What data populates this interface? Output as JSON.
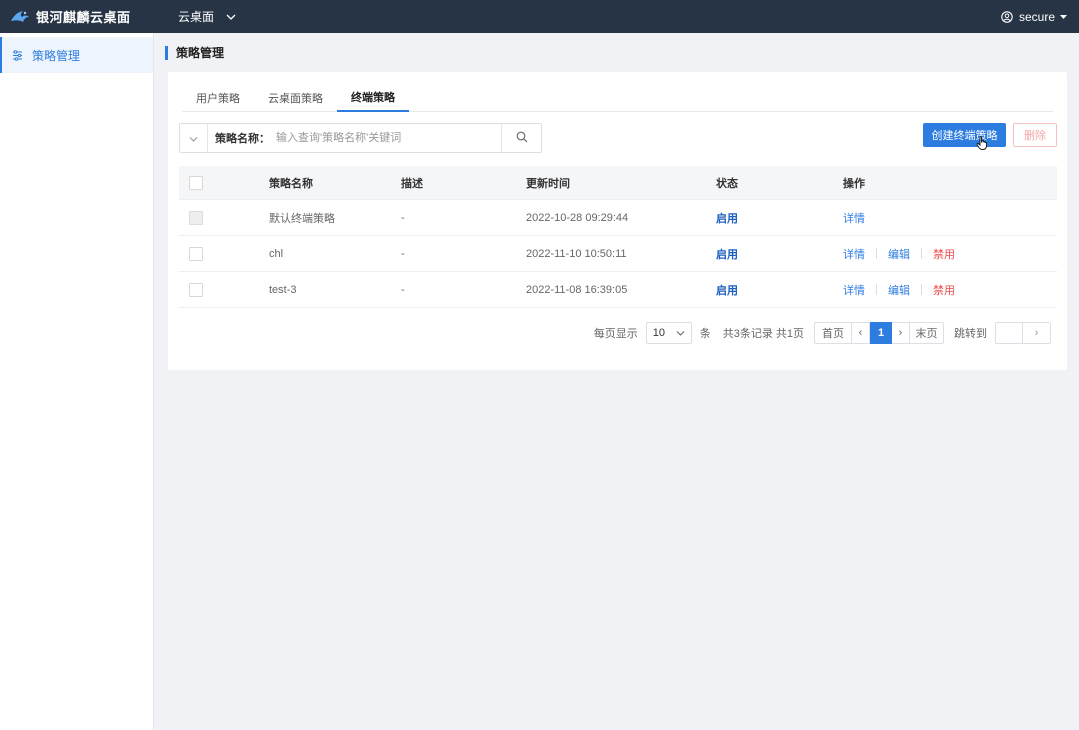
{
  "app": {
    "brand": "银河麒麟云桌面",
    "nav_menu": "云桌面",
    "user": "secure"
  },
  "sidebar": {
    "items": [
      {
        "label": "策略管理",
        "icon": "policy-icon",
        "active": true
      }
    ]
  },
  "page": {
    "title": "策略管理"
  },
  "tabs": [
    {
      "label": "用户策略",
      "active": false
    },
    {
      "label": "云桌面策略",
      "active": false
    },
    {
      "label": "终端策略",
      "active": true
    }
  ],
  "search": {
    "label": "策略名称：",
    "placeholder": "输入查询'策略名称'关键词",
    "value": ""
  },
  "actions": {
    "create": "创建终端策略",
    "delete": "删除"
  },
  "table": {
    "headers": {
      "name": "策略名称",
      "desc": "描述",
      "time": "更新时间",
      "status": "状态",
      "ops": "操作"
    },
    "rows": [
      {
        "name": "默认终端策略",
        "desc": "-",
        "time": "2022-10-28 09:29:44",
        "status": "启用",
        "ops": [
          "详情"
        ]
      },
      {
        "name": "chl",
        "desc": "-",
        "time": "2022-11-10 10:50:11",
        "status": "启用",
        "ops": [
          "详情",
          "编辑",
          "禁用"
        ]
      },
      {
        "name": "test-3",
        "desc": "-",
        "time": "2022-11-08 16:39:05",
        "status": "启用",
        "ops": [
          "详情",
          "编辑",
          "禁用"
        ]
      }
    ]
  },
  "pagination": {
    "per_page_label": "每页显示",
    "page_size": "10",
    "unit": "条",
    "total": "共3条记录 共1页",
    "first": "首页",
    "prev": "‹",
    "current": "1",
    "next": "›",
    "last": "末页",
    "jump_label": "跳转到",
    "jump_go": "›"
  },
  "colors": {
    "topbar": "#263445",
    "accent": "#2d7de0",
    "danger": "#e94c4c"
  }
}
